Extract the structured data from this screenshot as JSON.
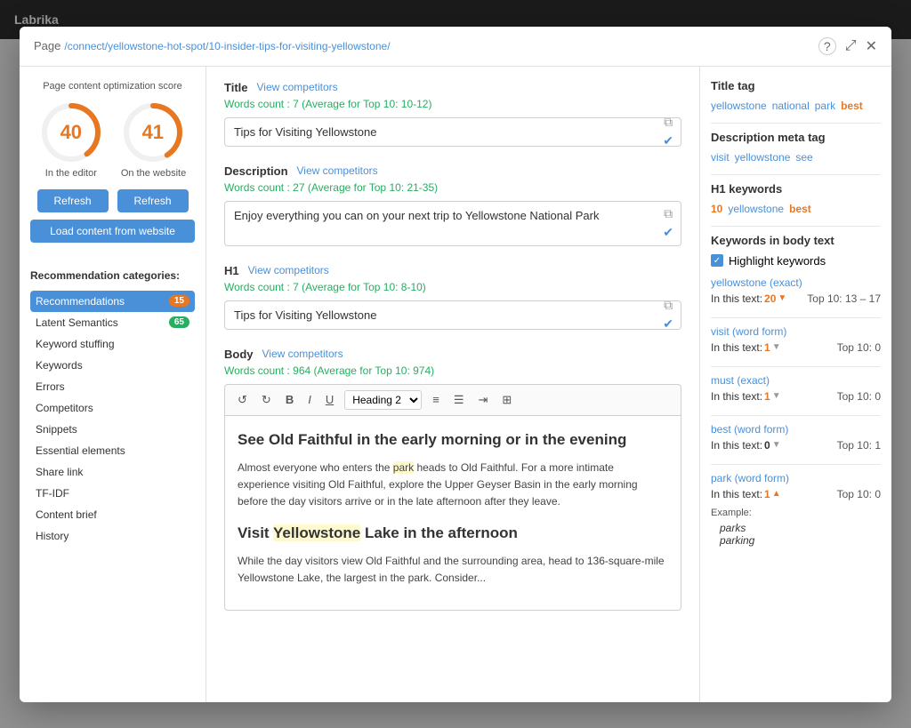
{
  "modal": {
    "header": {
      "page_label": "Page",
      "page_url": "/connect/yellowstone-hot-spot/10-insider-tips-for-visiting-yellowstone/"
    },
    "icons": {
      "help": "?",
      "expand": "⤢",
      "close": "✕"
    }
  },
  "left_panel": {
    "score_section_title": "Page content optimization score",
    "score_editor": "40",
    "score_website": "41",
    "label_editor": "In the editor",
    "label_website": "On the website",
    "btn_refresh": "Refresh",
    "btn_load": "Load content from website",
    "rec_title": "Recommendation categories:",
    "items": [
      {
        "label": "Recommendations",
        "badge": "15",
        "badge_type": "orange",
        "active": true
      },
      {
        "label": "Latent Semantics",
        "badge": "65",
        "badge_type": "green",
        "active": false
      },
      {
        "label": "Keyword stuffing",
        "badge": "",
        "badge_type": "",
        "active": false
      },
      {
        "label": "Keywords",
        "badge": "",
        "badge_type": "",
        "active": false
      },
      {
        "label": "Errors",
        "badge": "",
        "badge_type": "",
        "active": false
      },
      {
        "label": "Competitors",
        "badge": "",
        "badge_type": "",
        "active": false
      },
      {
        "label": "Snippets",
        "badge": "",
        "badge_type": "",
        "active": false
      },
      {
        "label": "Essential elements",
        "badge": "",
        "badge_type": "",
        "active": false
      },
      {
        "label": "Share link",
        "badge": "",
        "badge_type": "",
        "active": false
      },
      {
        "label": "TF-IDF",
        "badge": "",
        "badge_type": "",
        "active": false
      },
      {
        "label": "Content brief",
        "badge": "",
        "badge_type": "",
        "active": false
      },
      {
        "label": "History",
        "badge": "",
        "badge_type": "",
        "active": false
      }
    ]
  },
  "middle_panel": {
    "title_section": {
      "label": "Title",
      "view_competitors": "View competitors",
      "word_count": "Words count : 7 (Average for Top 10: 10-12)",
      "value": "Tips for Visiting Yellowstone"
    },
    "description_section": {
      "label": "Description",
      "view_competitors": "View competitors",
      "word_count": "Words count : 27 (Average for Top 10: 21-35)",
      "value": "Enjoy everything you can on your next trip to Yellowstone National Park"
    },
    "h1_section": {
      "label": "H1",
      "view_competitors": "View competitors",
      "word_count": "Words count : 7 (Average for Top 10: 8-10)",
      "value": "Tips for Visiting Yellowstone"
    },
    "body_section": {
      "label": "Body",
      "view_competitors": "View competitors",
      "word_count": "Words count : 964 (Average for Top 10: 974)",
      "toolbar": {
        "undo": "↺",
        "redo": "↻",
        "bold": "B",
        "italic": "I",
        "underline": "U",
        "heading_select": "Heading 2",
        "list_ordered": "≡",
        "list_unordered": "☰",
        "indent": "⇥",
        "table": "⊞"
      },
      "content_h2": "See Old Faithful in the early morning or in the evening",
      "content_p1": "Almost everyone who enters the park heads to Old Faithful. For a more intimate experience visiting Old Faithful, explore the Upper Geyser Basin in the early morning before the day visitors arrive or in the late afternoon after they leave.",
      "content_h2_2": "Visit Yellowstone Lake in the afternoon",
      "content_p2": "While the day visitors view Old Faithful and the surrounding area, head to 136-square-mile Yellowstone Lake, the largest in the park. Consider..."
    }
  },
  "right_panel": {
    "title_tag_section": {
      "title": "Title tag",
      "tags": [
        "yellowstone",
        "national",
        "park",
        "best"
      ]
    },
    "description_meta_section": {
      "title": "Description meta tag",
      "tags": [
        "visit",
        "yellowstone",
        "see"
      ]
    },
    "h1_keywords_section": {
      "title": "H1 keywords",
      "num": "10",
      "tags": [
        "yellowstone",
        "best"
      ]
    },
    "body_keywords_section": {
      "title": "Keywords in body text",
      "highlight_label": "Highlight keywords",
      "keywords": [
        {
          "name": "yellowstone (exact)",
          "in_text_label": "In this text:",
          "in_text_count": "20",
          "in_text_arrow": "▼",
          "top10_label": "Top 10:",
          "top10_range": "13 – 17",
          "expanded": false
        },
        {
          "name": "visit (word form)",
          "in_text_label": "In this text:",
          "in_text_count": "1",
          "in_text_arrow": "▼",
          "top10_label": "Top 10:",
          "top10_value": "0",
          "expanded": false
        },
        {
          "name": "must (exact)",
          "in_text_label": "In this text:",
          "in_text_count": "1",
          "in_text_arrow": "▼",
          "top10_label": "Top 10:",
          "top10_value": "0",
          "expanded": false
        },
        {
          "name": "best (word form)",
          "in_text_label": "In this text:",
          "in_text_count": "0",
          "in_text_arrow": "▼",
          "top10_label": "Top 10:",
          "top10_value": "1",
          "expanded": false
        },
        {
          "name": "park (word form)",
          "in_text_label": "In this text:",
          "in_text_count": "1",
          "in_text_arrow": "▲",
          "top10_label": "Top 10:",
          "top10_value": "0",
          "expanded": true,
          "example_label": "Example:",
          "example_words": [
            "parks",
            "parking"
          ]
        }
      ]
    }
  }
}
